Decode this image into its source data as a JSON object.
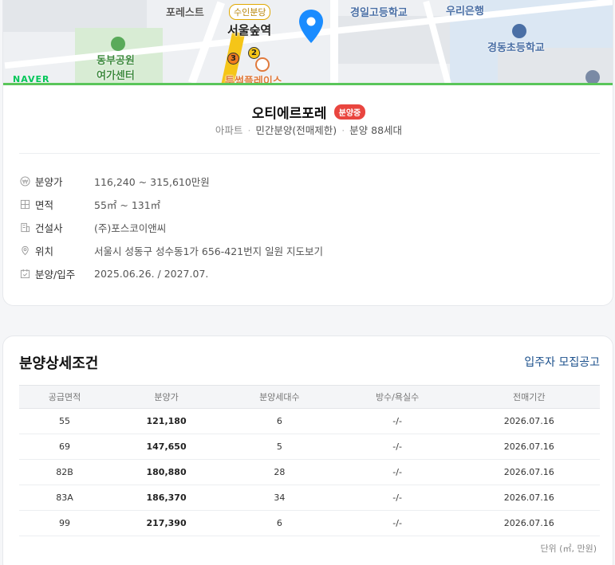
{
  "map": {
    "labels": {
      "forest": "포레스트",
      "suin_line": "수인분당",
      "station": "서울숲역",
      "park_center_1": "동부공원",
      "park_center_2": "여가센터",
      "place": "투썸플레이스",
      "high_school": "경일고등학교",
      "bank": "우리은행",
      "elementary": "경동초등학교",
      "line3": "3",
      "line2": "2",
      "naver": "NAVER"
    },
    "colors": {
      "pin": "#1a8cff",
      "border": "#5ac65a"
    }
  },
  "listing": {
    "title": "오티에르포레",
    "status_badge": "분양중",
    "type": "아파트",
    "sale_type": "민간분양(전매제한)",
    "units": "분양 88세대"
  },
  "info": [
    {
      "icon": "won-icon",
      "label": "분양가",
      "value": "116,240 ~ 315,610만원"
    },
    {
      "icon": "area-icon",
      "label": "면적",
      "value": "55㎡ ~ 131㎡"
    },
    {
      "icon": "building-icon",
      "label": "건설사",
      "value": "(주)포스코이앤씨"
    },
    {
      "icon": "location-icon",
      "label": "위치",
      "value": "서울시 성동구 성수동1가 656-421번지 일원 지도보기"
    },
    {
      "icon": "calendar-icon",
      "label": "분양/입주",
      "value": "2025.06.26. / 2027.07."
    }
  ],
  "conditions": {
    "title": "분양상세조건",
    "link": "입주자 모집공고",
    "headers": [
      "공급면적",
      "분양가",
      "분양세대수",
      "방수/욕실수",
      "전매기간"
    ],
    "rows": [
      [
        "55",
        "121,180",
        "6",
        "-/-",
        "2026.07.16"
      ],
      [
        "69",
        "147,650",
        "5",
        "-/-",
        "2026.07.16"
      ],
      [
        "82B",
        "180,880",
        "28",
        "-/-",
        "2026.07.16"
      ],
      [
        "83A",
        "186,370",
        "34",
        "-/-",
        "2026.07.16"
      ],
      [
        "99",
        "217,390",
        "6",
        "-/-",
        "2026.07.16"
      ]
    ],
    "unit_note": "단위 (㎡, 만원)"
  }
}
